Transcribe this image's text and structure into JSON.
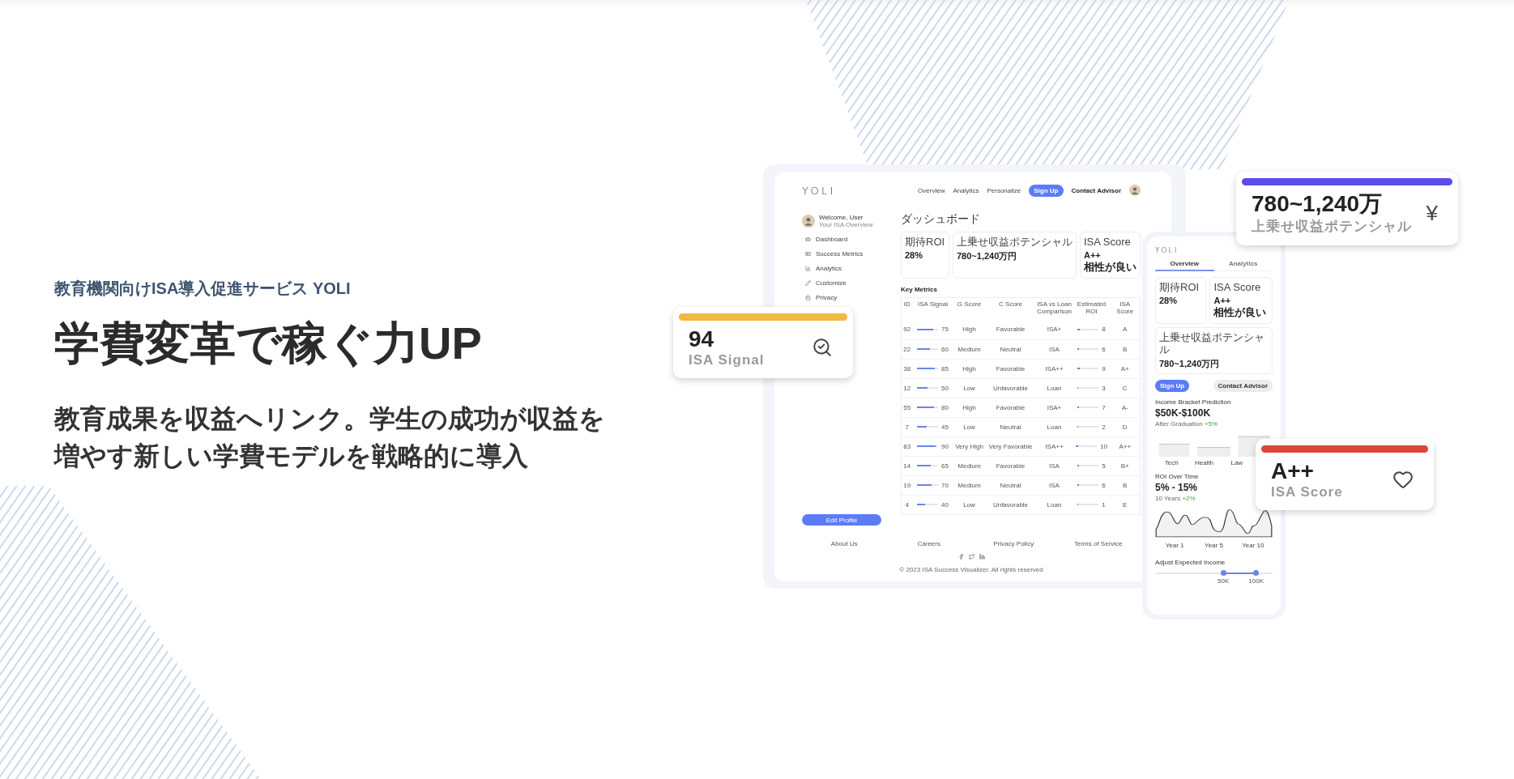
{
  "hero": {
    "eyebrow": "教育機関向けISA導入促進サービス YOLI",
    "headline": "学費変革で稼ぐ力UP",
    "lead": "教育成果を収益へリンク。学生の成功が収益を増やす新しい学費モデルを戦略的に導入"
  },
  "desktop": {
    "logo": "YOLI",
    "nav": [
      "Overview",
      "Analytics",
      "Personalize"
    ],
    "signup": "Sign Up",
    "contact": "Contact Advisor",
    "user": {
      "name": "Welcome, User",
      "sub": "Your ISA Overview"
    },
    "menu": [
      "Dashboard",
      "Success Metrics",
      "Analytics",
      "Customize",
      "Privacy"
    ],
    "edit_profile": "Edit Profile",
    "title": "ダッシュボード",
    "kpis": [
      {
        "label": "期待ROI",
        "value": "28%"
      },
      {
        "label": "上乗せ収益ポテンシャル",
        "value": "780~1,240万円"
      },
      {
        "label": "ISA Score",
        "value": "A++",
        "note": "相性が良い"
      }
    ],
    "table": {
      "title": "Key Metrics",
      "columns": [
        "ID",
        "ISA Signal",
        "G Score",
        "C Score",
        "ISA vs Loan Comparison",
        "Estimated ROI",
        "ISA Score"
      ],
      "rows": [
        {
          "id": "92",
          "signal": {
            "text": "75",
            "level": 0.75
          },
          "g": "High",
          "c": "Favorable",
          "cmp": "ISA+",
          "roi": {
            "text": "8",
            "level": 0.1
          },
          "score": "A"
        },
        {
          "id": "22",
          "signal": {
            "text": "60",
            "level": 0.6
          },
          "g": "Medium",
          "c": "Neutral",
          "cmp": "ISA",
          "roi": {
            "text": "6",
            "level": 0.06
          },
          "score": "B"
        },
        {
          "id": "38",
          "signal": {
            "text": "85",
            "level": 0.85
          },
          "g": "High",
          "c": "Favorable",
          "cmp": "ISA++",
          "roi": {
            "text": "9",
            "level": 0.1
          },
          "score": "A+"
        },
        {
          "id": "12",
          "signal": {
            "text": "50",
            "level": 0.5
          },
          "g": "Low",
          "c": "Unfavorable",
          "cmp": "Loan",
          "roi": {
            "text": "3",
            "level": 0.03
          },
          "score": "C"
        },
        {
          "id": "55",
          "signal": {
            "text": "80",
            "level": 0.8
          },
          "g": "High",
          "c": "Favorable",
          "cmp": "ISA+",
          "roi": {
            "text": "7",
            "level": 0.08
          },
          "score": "A-"
        },
        {
          "id": "7",
          "signal": {
            "text": "45",
            "level": 0.45
          },
          "g": "Low",
          "c": "Neutral",
          "cmp": "Loan",
          "roi": {
            "text": "2",
            "level": 0.02
          },
          "score": "D"
        },
        {
          "id": "83",
          "signal": {
            "text": "90",
            "level": 0.9
          },
          "g": "Very High",
          "c": "Very Favorable",
          "cmp": "ISA++",
          "roi": {
            "text": "10",
            "level": 0.1
          },
          "score": "A++"
        },
        {
          "id": "14",
          "signal": {
            "text": "65",
            "level": 0.65
          },
          "g": "Medium",
          "c": "Favorable",
          "cmp": "ISA",
          "roi": {
            "text": "5",
            "level": 0.05
          },
          "score": "B+"
        },
        {
          "id": "19",
          "signal": {
            "text": "70",
            "level": 0.7
          },
          "g": "Medium",
          "c": "Neutral",
          "cmp": "ISA",
          "roi": {
            "text": "6",
            "level": 0.08
          },
          "score": "B"
        },
        {
          "id": "4",
          "signal": {
            "text": "40",
            "level": 0.4
          },
          "g": "Low",
          "c": "Unfavorable",
          "cmp": "Loan",
          "roi": {
            "text": "1",
            "level": 0.02
          },
          "score": "E"
        }
      ]
    },
    "footer": {
      "links": [
        "About Us",
        "Careers",
        "Privacy Policy",
        "Terms of Service"
      ],
      "copyright": "© 2023 ISA Success Visualizer. All rights reserved"
    }
  },
  "phone": {
    "logo": "YOLI",
    "tabs": [
      {
        "label": "Overview",
        "selected": true
      },
      {
        "label": "Analytics",
        "selected": false
      }
    ],
    "kpis": [
      {
        "label": "期待ROI",
        "value": "28%"
      },
      {
        "label": "ISA Score",
        "value": "A++",
        "note": "相性が良い"
      },
      {
        "label": "上乗せ収益ポテンシャル",
        "value": "780~1,240万円"
      }
    ],
    "signup": "Sign Up",
    "contact": "Contact Advisor",
    "income": {
      "label": "Income Bracket Prediction",
      "value": "$50K-$100K",
      "note": "After Graduation",
      "delta": "+5%"
    },
    "bar_labels": [
      "Tech",
      "Health",
      "Law"
    ],
    "roi": {
      "label": "ROI Over Time",
      "value": "5% - 15%",
      "note": "10 Years",
      "delta": "+2%"
    },
    "year_labels": [
      "Year 1",
      "Year 5",
      "Year 10"
    ],
    "slider": {
      "label": "Adjust Expected Income",
      "low": {
        "level": 0.58,
        "label": "50K"
      },
      "high": {
        "level": 0.86,
        "label": "100K"
      }
    }
  },
  "float_cards": [
    {
      "value": "780~1,240万",
      "label": "上乗せ収益ポテンシャル",
      "symbol": "¥",
      "color": "#5b4de8"
    },
    {
      "value": "94",
      "label": "ISA Signal",
      "color": "#f0b941"
    },
    {
      "value": "A++",
      "label": "ISA Score",
      "color": "#d9473a"
    }
  ]
}
